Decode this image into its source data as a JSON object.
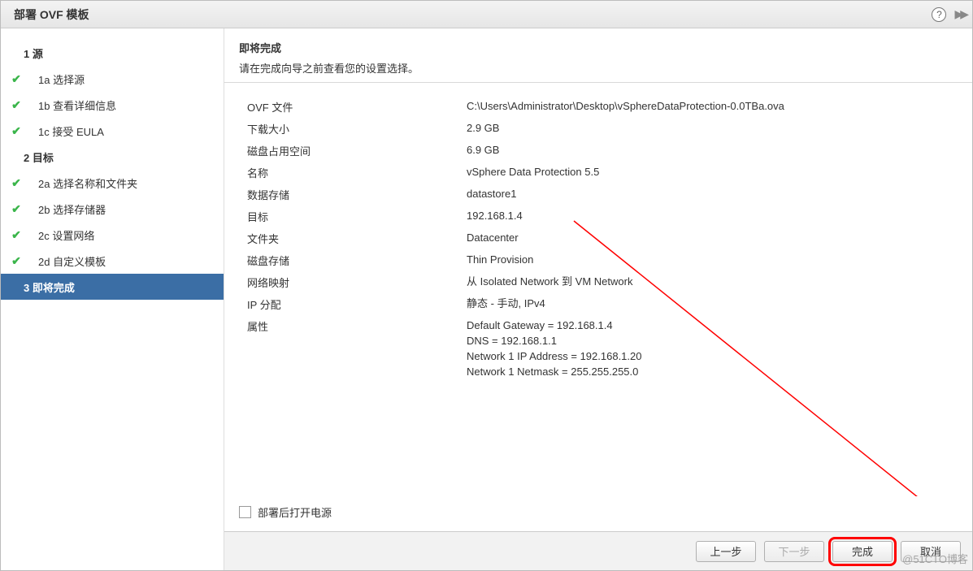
{
  "window": {
    "title": "部署 OVF 模板"
  },
  "sidebar": {
    "steps": [
      {
        "id": "1",
        "label": "1 源",
        "parent": true,
        "checked": false,
        "selected": false
      },
      {
        "id": "1a",
        "label": "1a 选择源",
        "parent": false,
        "checked": true,
        "selected": false
      },
      {
        "id": "1b",
        "label": "1b 查看详细信息",
        "parent": false,
        "checked": true,
        "selected": false
      },
      {
        "id": "1c",
        "label": "1c 接受 EULA",
        "parent": false,
        "checked": true,
        "selected": false
      },
      {
        "id": "2",
        "label": "2 目标",
        "parent": true,
        "checked": false,
        "selected": false
      },
      {
        "id": "2a",
        "label": "2a 选择名称和文件夹",
        "parent": false,
        "checked": true,
        "selected": false
      },
      {
        "id": "2b",
        "label": "2b 选择存储器",
        "parent": false,
        "checked": true,
        "selected": false
      },
      {
        "id": "2c",
        "label": "2c 设置网络",
        "parent": false,
        "checked": true,
        "selected": false
      },
      {
        "id": "2d",
        "label": "2d 自定义模板",
        "parent": false,
        "checked": true,
        "selected": false
      },
      {
        "id": "3",
        "label": "3 即将完成",
        "parent": true,
        "checked": true,
        "selected": true
      }
    ]
  },
  "main": {
    "heading": "即将完成",
    "subheading": "请在完成向导之前查看您的设置选择。",
    "rows": [
      {
        "label": "OVF 文件",
        "value": "C:\\Users\\Administrator\\Desktop\\vSphereDataProtection-0.0TBa.ova"
      },
      {
        "label": "下载大小",
        "value": "2.9 GB"
      },
      {
        "label": "磁盘占用空间",
        "value": "6.9 GB"
      },
      {
        "label": "名称",
        "value": "vSphere Data Protection 5.5"
      },
      {
        "label": "数据存储",
        "value": "datastore1"
      },
      {
        "label": "目标",
        "value": "192.168.1.4"
      },
      {
        "label": "文件夹",
        "value": "Datacenter"
      },
      {
        "label": "磁盘存储",
        "value": "Thin Provision"
      },
      {
        "label": "网络映射",
        "value": "从 Isolated Network 到 VM Network"
      },
      {
        "label": "IP 分配",
        "value": "静态 - 手动, IPv4"
      },
      {
        "label": "属性",
        "value": "Default Gateway = 192.168.1.4\nDNS = 192.168.1.1\nNetwork 1 IP Address = 192.168.1.20\nNetwork 1 Netmask = 255.255.255.0"
      }
    ],
    "power_on_label": "部署后打开电源",
    "power_on_checked": false
  },
  "footer": {
    "back": "上一步",
    "next": "下一步",
    "finish": "完成",
    "cancel": "取消"
  },
  "watermark": "@51CTO博客"
}
